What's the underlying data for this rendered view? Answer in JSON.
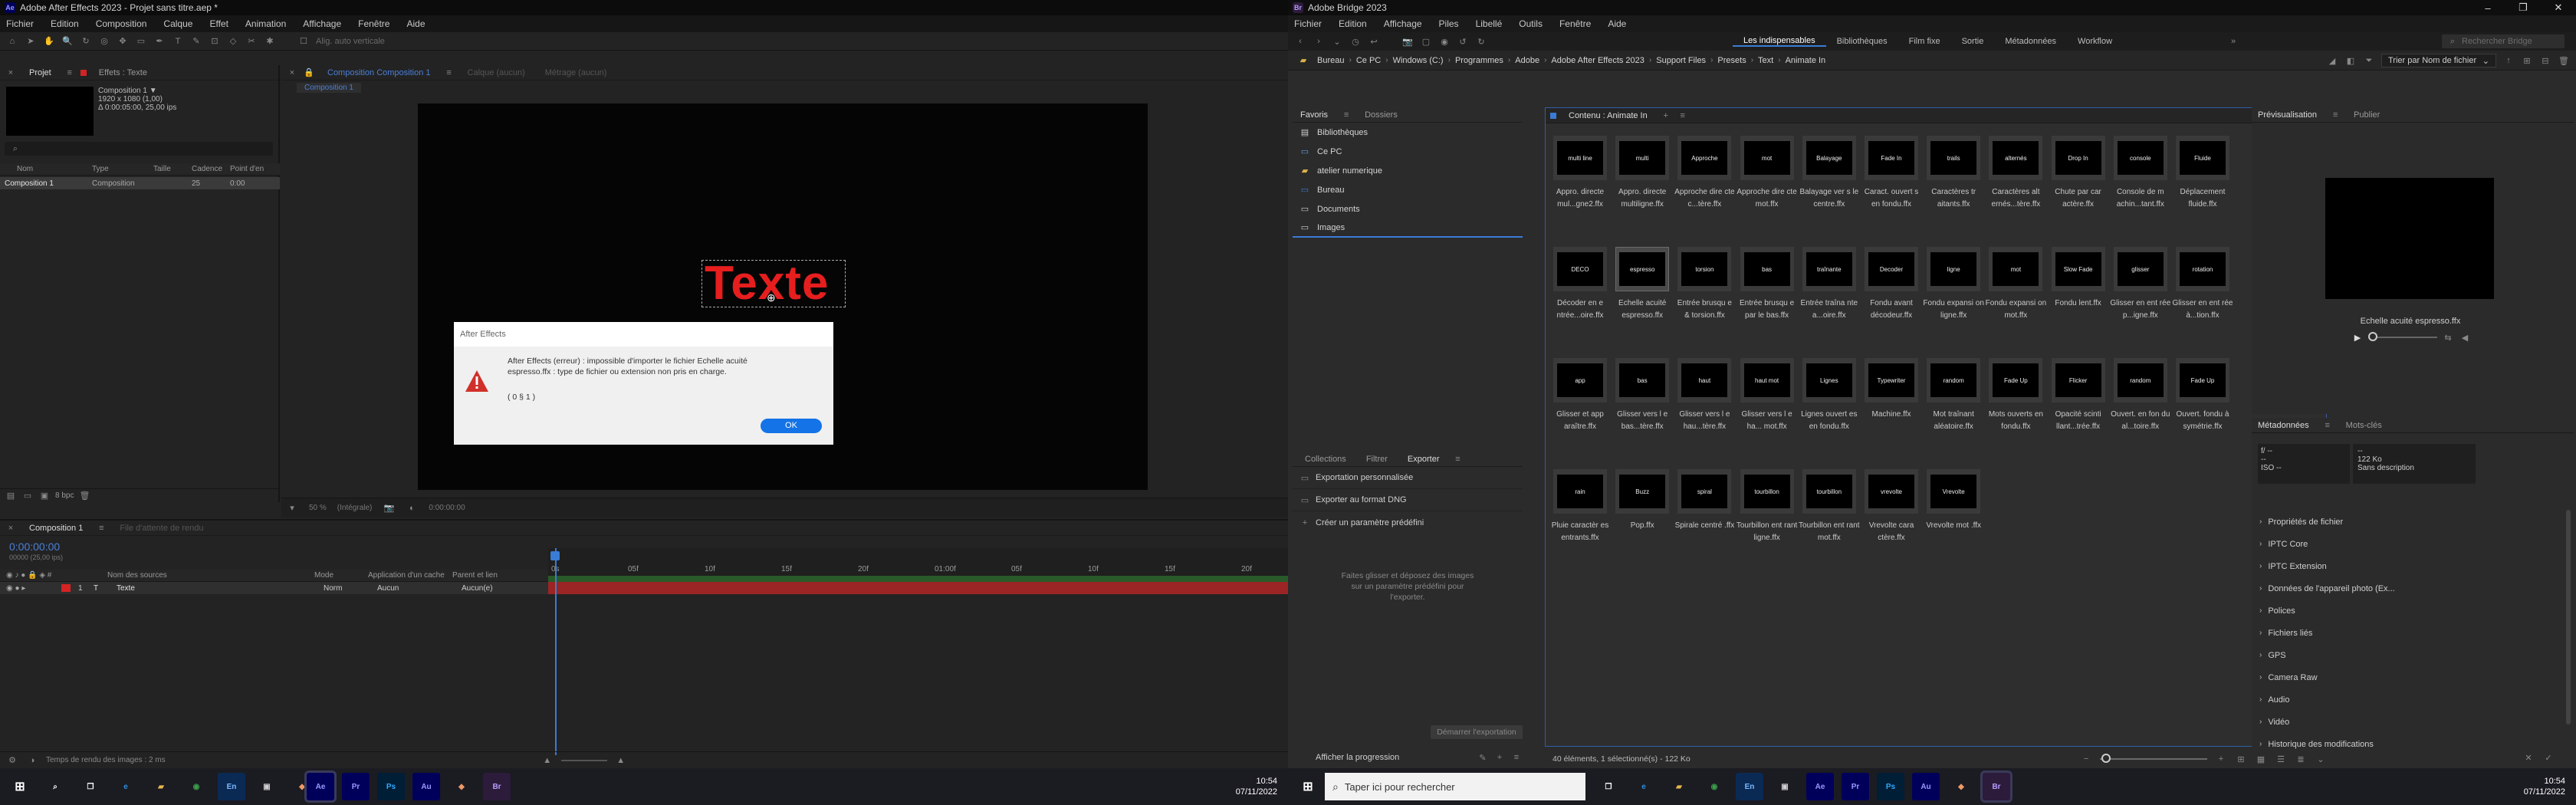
{
  "ae": {
    "title": "Adobe After Effects 2023 - Projet sans titre.aep *",
    "menu": [
      "Fichier",
      "Edition",
      "Composition",
      "Calque",
      "Effet",
      "Animation",
      "Affichage",
      "Fenêtre",
      "Aide"
    ],
    "toolbar_hint": "Alig. auto verticale",
    "project": {
      "tab_project": "Projet",
      "tab_effects": "Effets : Texte",
      "comp_name": "Composition 1 ▼",
      "comp_size": "1920 x 1080 (1,00)",
      "comp_duration": "Δ 0:00:05:00, 25,00 ips",
      "columns": [
        "Nom",
        "Type",
        "Taille",
        "Cadence",
        "Point d'en"
      ],
      "item": {
        "name": "Composition 1",
        "type": "Composition",
        "fps": "25",
        "in": "0:00"
      }
    },
    "viewer": {
      "tab_comp": "Composition",
      "tab_comp_name": "Composition 1",
      "tab_layer": "Calque (aucun)",
      "tab_footage": "Métrage (aucun)",
      "breadcrumb": "Composition 1",
      "canvas_text": "Texte",
      "status_zoom": "50 %",
      "status_res": "(Intégrale)",
      "status_time": "0:00:00:00"
    },
    "dialog": {
      "title": "After Effects",
      "message": "After Effects (erreur) : impossible d'importer le fichier Echelle acuité espresso.ffx : type de fichier ou extension non pris en charge.",
      "code": "( 0 § 1 )",
      "ok_label": "OK"
    },
    "timeline": {
      "comp_tab": "Composition 1",
      "render_queue": "File d'attente de rendu",
      "timecode": "0:00:00:00",
      "timecode_sub": "00000 (25,00 ips)",
      "col_layer": "Nom des sources",
      "col_mode": "Mode",
      "col_trkmat": "Application d'un cache",
      "col_parent": "Parent et lien",
      "layer_num": "1",
      "layer_name": "Texte",
      "layer_mode": "Norm",
      "layer_matte": "Aucun",
      "layer_parent": "Aucun(e)",
      "ruler": [
        "0s",
        "05f",
        "10f",
        "15f",
        "20f",
        "01:00f",
        "05f",
        "10f",
        "15f",
        "20f"
      ],
      "footer": "Temps de rendu des images : 2 ms"
    },
    "project_footer": "8 bpc"
  },
  "bridge": {
    "title": "Adobe Bridge 2023",
    "menu": [
      "Fichier",
      "Edition",
      "Affichage",
      "Piles",
      "Libellé",
      "Outils",
      "Fenêtre",
      "Aide"
    ],
    "workspaces": [
      "Les indispensables",
      "Bibliothèques",
      "Film fixe",
      "Sortie",
      "Métadonnées",
      "Workflow"
    ],
    "search_placeholder": "Rechercher Bridge",
    "path": [
      "Bureau",
      "Ce PC",
      "Windows (C:)",
      "Programmes",
      "Adobe",
      "Adobe After Effects 2023",
      "Support Files",
      "Presets",
      "Text",
      "Animate In"
    ],
    "sort_label": "Trier par Nom de fichier",
    "favorites": {
      "tab1": "Favoris",
      "tab2": "Dossiers",
      "items": [
        "Bibliothèques",
        "Ce PC",
        "atelier numerique",
        "Bureau",
        "Documents",
        "Images"
      ]
    },
    "export": {
      "tabs": [
        "Collections",
        "Filtrer",
        "Exporter"
      ],
      "items": [
        "Exportation personnalisée",
        "Exporter au format DNG",
        "Créer un paramètre prédéfini"
      ],
      "drop_hint": "Faites glisser et déposez des images sur un paramètre prédéfini pour l'exporter.",
      "start_button": "Démarrer l'exportation",
      "progress": "Afficher la progression"
    },
    "content": {
      "tab": "Contenu : Animate In",
      "status": "40 éléments, 1 sélectionné(s) - 122 Ko",
      "items": [
        {
          "label": "Appro. directe mul...gne2.ffx",
          "thumb": "multi line"
        },
        {
          "label": "Appro. directe multiligne.ffx",
          "thumb": "multi"
        },
        {
          "label": "Approche dire cte c...tère.ffx",
          "thumb": "Approche"
        },
        {
          "label": "Approche dire cte mot.ffx",
          "thumb": "mot"
        },
        {
          "label": "Balayage ver s le centre.ffx",
          "thumb": "Balayage"
        },
        {
          "label": "Caract. ouvert s en fondu.ffx",
          "thumb": "Fade In"
        },
        {
          "label": "Caractères tr aitants.ffx",
          "thumb": "trails"
        },
        {
          "label": "Caractères alt ernés...tère.ffx",
          "thumb": "alternés"
        },
        {
          "label": "Chute par car actère.ffx",
          "thumb": "Drop In"
        },
        {
          "label": "Console de m achin...tant.ffx",
          "thumb": "console"
        },
        {
          "label": "Déplacement fluide.ffx",
          "thumb": "Fluide"
        },
        {
          "label": "Décoder en e ntrée...oire.ffx",
          "thumb": "DECO"
        },
        {
          "label": "Echelle acuité espresso.ffx",
          "thumb": "espresso"
        },
        {
          "label": "Entrée brusqu e & torsion.ffx",
          "thumb": "torsion"
        },
        {
          "label": "Entrée brusqu e par le bas.ffx",
          "thumb": "bas"
        },
        {
          "label": "Entrée traîna nte a...oire.ffx",
          "thumb": "traînante"
        },
        {
          "label": "Fondu avant décodeur.ffx",
          "thumb": "Decoder"
        },
        {
          "label": "Fondu expansi on ligne.ffx",
          "thumb": "ligne"
        },
        {
          "label": "Fondu expansi on mot.ffx",
          "thumb": "mot"
        },
        {
          "label": "Fondu lent.ffx",
          "thumb": "Slow Fade"
        },
        {
          "label": "Glisser en ent rée p...igne.ffx",
          "thumb": "glisser"
        },
        {
          "label": "Glisser en ent rée à...tion.ffx",
          "thumb": "rotation"
        },
        {
          "label": "Glisser et app araître.ffx",
          "thumb": "app"
        },
        {
          "label": "Glisser vers l e bas...tère.ffx",
          "thumb": "bas"
        },
        {
          "label": "Glisser vers l e hau...tère.ffx",
          "thumb": "haut"
        },
        {
          "label": "Glisser vers l e ha... mot.ffx",
          "thumb": "haut mot"
        },
        {
          "label": "Lignes ouvert es en fondu.ffx",
          "thumb": "Lignes"
        },
        {
          "label": "Machine.ffx",
          "thumb": "Typewriter"
        },
        {
          "label": "Mot traînant aléatoire.ffx",
          "thumb": "random"
        },
        {
          "label": "Mots ouverts en fondu.ffx",
          "thumb": "Fade Up"
        },
        {
          "label": "Opacité scinti llant...trée.ffx",
          "thumb": "Flicker"
        },
        {
          "label": "Ouvert. en fon du al...toire.ffx",
          "thumb": "random"
        },
        {
          "label": "Ouvert. fondu à symétrie.ffx",
          "thumb": "Fade Up"
        },
        {
          "label": "Pluie caractèr es entrants.ffx",
          "thumb": "rain"
        },
        {
          "label": "Pop.ffx",
          "thumb": "Buzz"
        },
        {
          "label": "Spirale centré .ffx",
          "thumb": "spiral"
        },
        {
          "label": "Tourbillon ent rant ligne.ffx",
          "thumb": "tourbillon"
        },
        {
          "label": "Tourbillon ent rant mot.ffx",
          "thumb": "tourbillon"
        },
        {
          "label": "Vrevolte cara ctère.ffx",
          "thumb": "vrevolte"
        },
        {
          "label": "Vrevolte mot .ffx",
          "thumb": "Vrevolte"
        }
      ]
    },
    "preview": {
      "tab1": "Prévisualisation",
      "tab2": "Publier",
      "filename": "Echelle acuité espresso.ffx"
    },
    "metadata": {
      "tab1": "Métadonnées",
      "tab2": "Mots-clés",
      "f_stop": "f/ --",
      "shutter": "--",
      "size": "122 Ko",
      "iso": "ISO --",
      "desc": "Sans description",
      "sections": [
        "Propriétés de fichier",
        "IPTC Core",
        "IPTC Extension",
        "Données de l'appareil photo (Ex...",
        "Polices",
        "Fichiers liés",
        "GPS",
        "Camera Raw",
        "Audio",
        "Vidéo",
        "Historique des modifications"
      ]
    }
  },
  "taskbar": {
    "search_placeholder": "Taper ici pour rechercher",
    "time": "10:54",
    "date": "07/11/2022"
  }
}
